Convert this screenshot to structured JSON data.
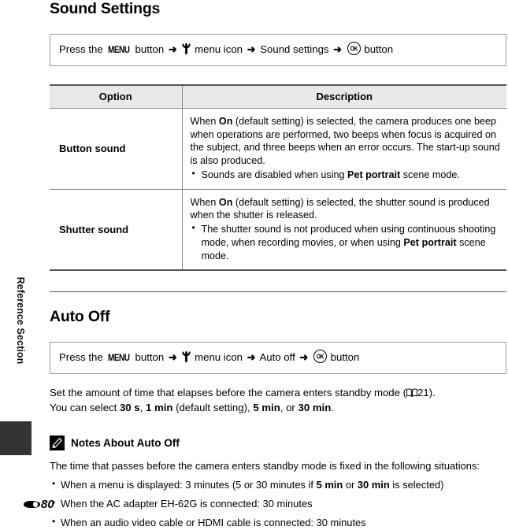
{
  "sidebar": {
    "section_label": "Reference Section",
    "tab_color": "#333333"
  },
  "footer": {
    "section_glyph": "E",
    "page_number": "80"
  },
  "sections": [
    {
      "heading": "Sound Settings",
      "path": {
        "prefix": "Press the",
        "menu_button": "MENU",
        "button_word": "button",
        "arrow": "➜",
        "menu_icon_name": "setup-wrench-icon",
        "menu_icon_label": "menu icon",
        "item": "Sound settings",
        "ok_button": "OK",
        "ok_word": "button"
      }
    },
    {
      "heading": "Auto Off",
      "path": {
        "prefix": "Press the",
        "menu_button": "MENU",
        "button_word": "button",
        "arrow": "➜",
        "menu_icon_name": "setup-wrench-icon",
        "menu_icon_label": "menu icon",
        "item": "Auto off",
        "ok_button": "OK",
        "ok_word": "button"
      }
    }
  ],
  "table": {
    "headers": [
      "Option",
      "Description"
    ],
    "rows": [
      {
        "option": "Button sound",
        "paragraph_parts": [
          "When ",
          "On",
          " (default setting) is selected, the camera produces one beep when operations are performed, two beeps when focus is acquired on the subject, and three beeps when an error occurs. The start-up sound is also produced."
        ],
        "bullets_parts": [
          [
            "Sounds are disabled when using ",
            "Pet portrait",
            " scene mode."
          ]
        ]
      },
      {
        "option": "Shutter sound",
        "paragraph_parts": [
          "When ",
          "On",
          " (default setting) is selected, the shutter sound is produced when the shutter is released."
        ],
        "bullets_parts": [
          [
            "The shutter sound is not produced when using continuous shooting mode, when recording movies, or when using ",
            "Pet portrait",
            " scene mode."
          ]
        ]
      }
    ]
  },
  "auto_off_body": {
    "line1_before": "Set the amount of time that elapses before the camera enters standby mode (",
    "line1_ref": "21",
    "line1_after": ").",
    "line2_before": "You can select ",
    "opt1": "30 s",
    "sep1": ", ",
    "opt2": "1 min",
    "mid": " (default setting), ",
    "opt3": "5 min",
    "sep2": ", or ",
    "opt4": "30 min",
    "end": "."
  },
  "notes": {
    "icon_name": "pencil-note-icon",
    "title": "Notes About Auto Off",
    "intro": "The time that passes before the camera enters standby mode is fixed in the following situations:",
    "items": [
      {
        "parts": [
          "When a menu is displayed: 3 minutes (5 or 30 minutes if ",
          "5 min",
          " or ",
          "30 min",
          " is selected)"
        ]
      },
      {
        "parts": [
          "When the AC adapter EH-62G is connected: 30 minutes"
        ]
      },
      {
        "parts": [
          "When an audio video cable or HDMI cable is connected: 30 minutes"
        ]
      }
    ]
  }
}
